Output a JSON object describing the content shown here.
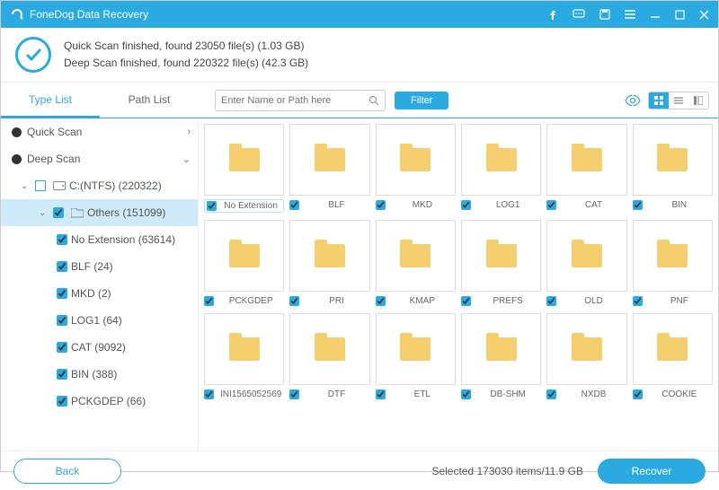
{
  "app_title": "FoneDog Data Recovery",
  "scan": {
    "line1": "Quick Scan finished, found 23050 file(s) (1.03 GB)",
    "line2": "Deep Scan finished, found 220322 file(s) (42.3 GB)"
  },
  "tabs": {
    "type_list": "Type List",
    "path_list": "Path List"
  },
  "search": {
    "placeholder": "Enter Name or Path here"
  },
  "filter_label": "Filter",
  "tree": {
    "quick_scan": "Quick Scan",
    "deep_scan": "Deep Scan",
    "drive": "C:(NTFS) (220322)",
    "others": "Others (151099)",
    "items": [
      "No Extension (63614)",
      "BLF (24)",
      "MKD (2)",
      "LOG1 (64)",
      "CAT (9092)",
      "BIN (388)",
      "PCKGDEP (66)"
    ]
  },
  "grid": [
    "No Extension",
    "BLF",
    "MKD",
    "LOG1",
    "CAT",
    "BIN",
    "PCKGDEP",
    "PRI",
    "KMAP",
    "PREFS",
    "OLD",
    "PNF",
    "INI1565052569",
    "DTF",
    "ETL",
    "DB-SHM",
    "NXDB",
    "COOKIE"
  ],
  "footer": {
    "back": "Back",
    "selected": "Selected 173030 items/11.9 GB",
    "recover": "Recover"
  }
}
